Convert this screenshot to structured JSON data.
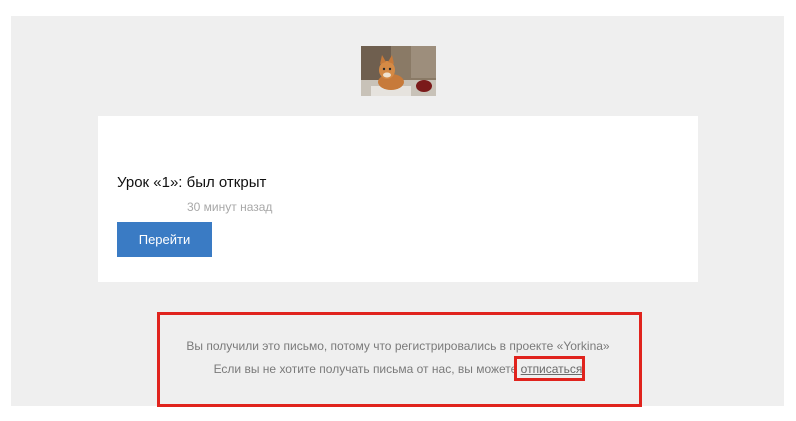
{
  "logo": {
    "icon": "cat-photo-logo"
  },
  "card": {
    "title": "Урок «1»: был открыт",
    "time": "30 минут назад",
    "button_label": "Перейти",
    "button_color": "#3a7bc4"
  },
  "footer": {
    "line1": "Вы получили это письмо, потому что регистрировались в проекте «Yorkina»",
    "line2_prefix": "Если вы не хотите получать письма от нас, вы можете ",
    "unsubscribe_label": "отписаться"
  },
  "colors": {
    "email_background": "#efefef",
    "highlight": "#e0231d"
  }
}
